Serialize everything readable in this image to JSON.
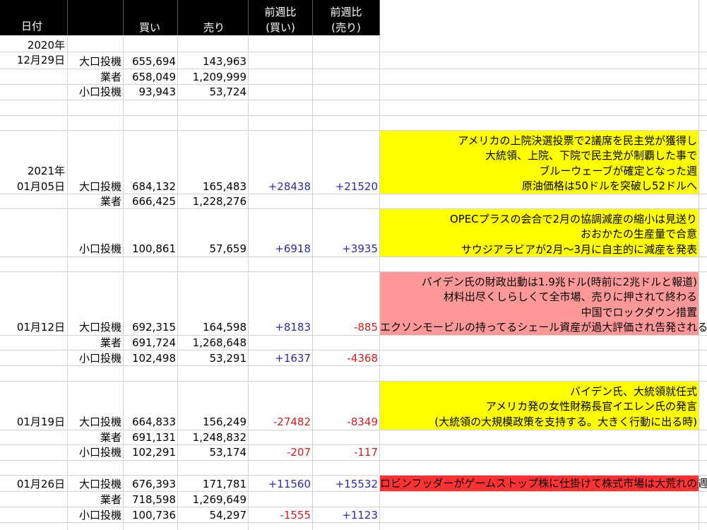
{
  "header": {
    "date": "日付",
    "buy": "買い",
    "sell": "売り",
    "wow_buy_1": "前週比",
    "wow_buy_2": "(買い)",
    "wow_sell_1": "前週比",
    "wow_sell_2": "(売り)"
  },
  "rows": [
    {
      "year": "2020年",
      "date": "12月29日",
      "type": "大口投機",
      "buy": "655,694",
      "sell": "143,963",
      "wow_buy": "",
      "wow_sell": ""
    },
    {
      "year": "",
      "date": "",
      "type": "業者",
      "buy": "658,049",
      "sell": "1,209,999",
      "wow_buy": "",
      "wow_sell": ""
    },
    {
      "year": "",
      "date": "",
      "type": "小口投機",
      "buy": "93,943",
      "sell": "53,724",
      "wow_buy": "",
      "wow_sell": ""
    },
    {
      "year": "2021年",
      "date": "01月05日",
      "type": "大口投機",
      "buy": "684,132",
      "sell": "165,483",
      "wow_buy": "+28438",
      "wow_sell": "+21520"
    },
    {
      "year": "",
      "date": "",
      "type": "業者",
      "buy": "666,425",
      "sell": "1,228,276",
      "wow_buy": "",
      "wow_sell": ""
    },
    {
      "year": "",
      "date": "",
      "type": "小口投機",
      "buy": "100,861",
      "sell": "57,659",
      "wow_buy": "+6918",
      "wow_sell": "+3935"
    },
    {
      "year": "",
      "date": "01月12日",
      "type": "大口投機",
      "buy": "692,315",
      "sell": "164,598",
      "wow_buy": "+8183",
      "wow_sell": "-885"
    },
    {
      "year": "",
      "date": "",
      "type": "業者",
      "buy": "691,724",
      "sell": "1,268,648",
      "wow_buy": "",
      "wow_sell": ""
    },
    {
      "year": "",
      "date": "",
      "type": "小口投機",
      "buy": "102,498",
      "sell": "53,291",
      "wow_buy": "+1637",
      "wow_sell": "-4368"
    },
    {
      "year": "",
      "date": "01月19日",
      "type": "大口投機",
      "buy": "664,833",
      "sell": "156,249",
      "wow_buy": "-27482",
      "wow_sell": "-8349"
    },
    {
      "year": "",
      "date": "",
      "type": "業者",
      "buy": "691,131",
      "sell": "1,248,832",
      "wow_buy": "",
      "wow_sell": ""
    },
    {
      "year": "",
      "date": "",
      "type": "小口投機",
      "buy": "102,291",
      "sell": "53,174",
      "wow_buy": "-207",
      "wow_sell": "-117"
    },
    {
      "year": "",
      "date": "01月26日",
      "type": "大口投機",
      "buy": "676,393",
      "sell": "171,781",
      "wow_buy": "+11560",
      "wow_sell": "+15532"
    },
    {
      "year": "",
      "date": "",
      "type": "業者",
      "buy": "718,598",
      "sell": "1,269,649",
      "wow_buy": "",
      "wow_sell": ""
    },
    {
      "year": "",
      "date": "",
      "type": "小口投機",
      "buy": "100,736",
      "sell": "54,297",
      "wow_buy": "-1555",
      "wow_sell": "+1123"
    }
  ],
  "notes": {
    "n1": [
      "アメリカの上院決選投票で2議席を民主党が獲得し",
      "大統領、上院、下院で民主党が制覇した事で",
      "ブルーウェーブが確定となった週",
      "原油価格は50ドルを突破し52ドルへ"
    ],
    "n2": [
      "OPECプラスの会合で2月の協調減産の縮小は見送り",
      "おおかたの生産量で合意",
      "サウジアラビアが2月～3月に自主的に減産を発表"
    ],
    "n3": [
      "バイデン氏の財政出動は1.9兆ドル(時前に2兆ドルと報道)",
      "材料出尽くしらしくて全市場、売りに押されて終わる",
      "中国でロックダウン措置",
      "エクソンモービルの持ってるシェール資産が過大評価され告発される"
    ],
    "n4": [
      "バイデン氏、大統領就任式",
      "アメリカ発の女性財務長官イエレン氏の発言",
      "(大統領の大規模政策を支持する。大きく行動に出る時)"
    ],
    "n5": [
      "ロビンフッダーがゲームストップ株に仕掛けて株式市場は大荒れの週"
    ]
  },
  "colors": {
    "positive": "#2b2bb0",
    "negative": "#d02020",
    "note_yellow": "#ffff00",
    "note_pink": "#ff9999",
    "note_red": "#ff3333"
  }
}
